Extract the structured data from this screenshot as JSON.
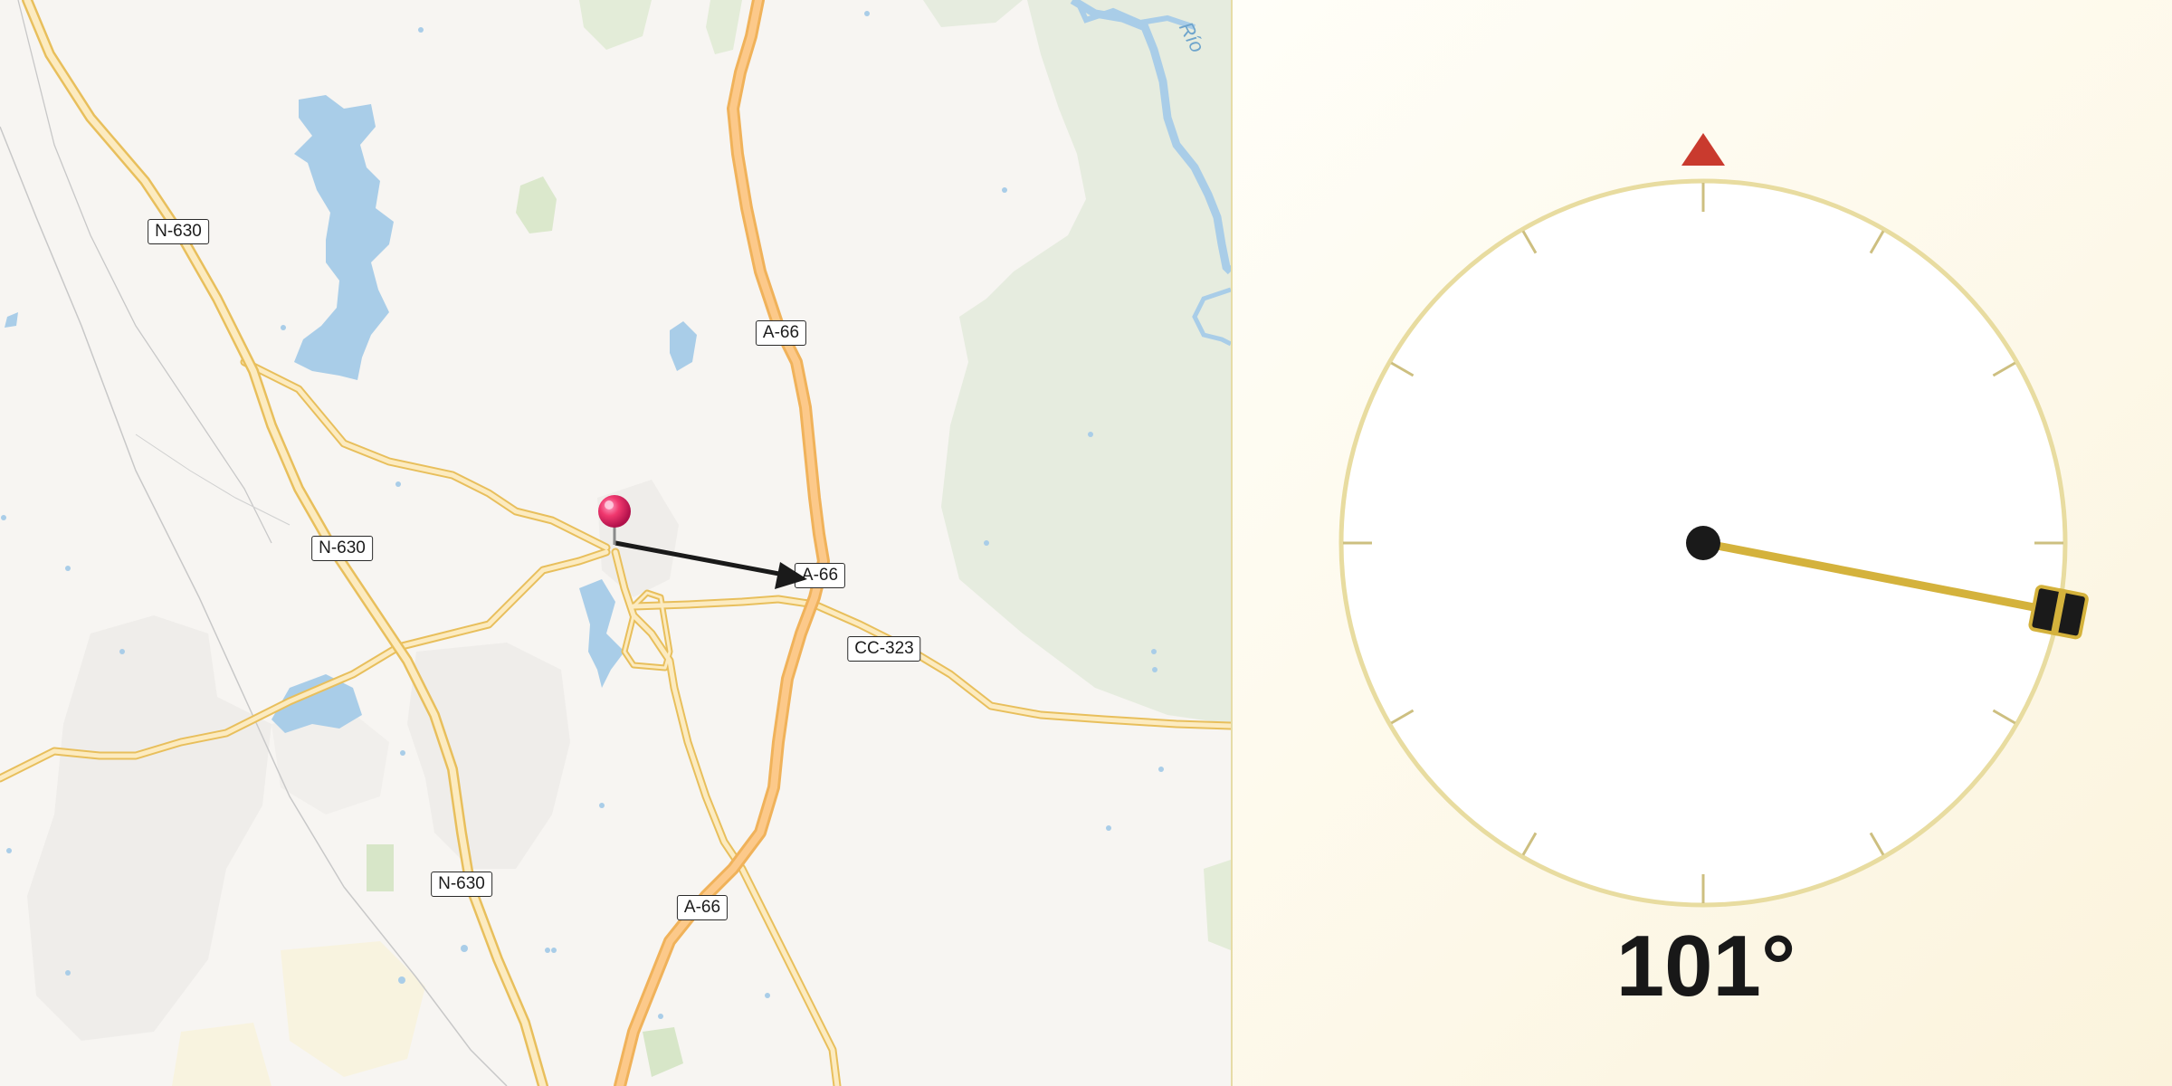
{
  "map": {
    "road_labels": [
      {
        "id": "n630-a",
        "text": "N-630"
      },
      {
        "id": "n630-b",
        "text": "N-630"
      },
      {
        "id": "n630-c",
        "text": "N-630"
      },
      {
        "id": "a66-a",
        "text": "A-66"
      },
      {
        "id": "a66-b",
        "text": "A-66"
      },
      {
        "id": "a66-c",
        "text": "A-66"
      },
      {
        "id": "cc323",
        "text": "CC-323"
      }
    ],
    "river_label": "Río",
    "pin_icon": "map-pin-icon",
    "arrow_icon": "direction-arrow-icon"
  },
  "compass": {
    "bearing_deg": 101,
    "bearing_text": "101°",
    "north_marker_icon": "north-triangle-icon",
    "colors": {
      "ring": "#e8dca0",
      "needle": "#d4b23c",
      "north_marker": "#c93a2e",
      "pivot": "#1a1a1a"
    }
  }
}
